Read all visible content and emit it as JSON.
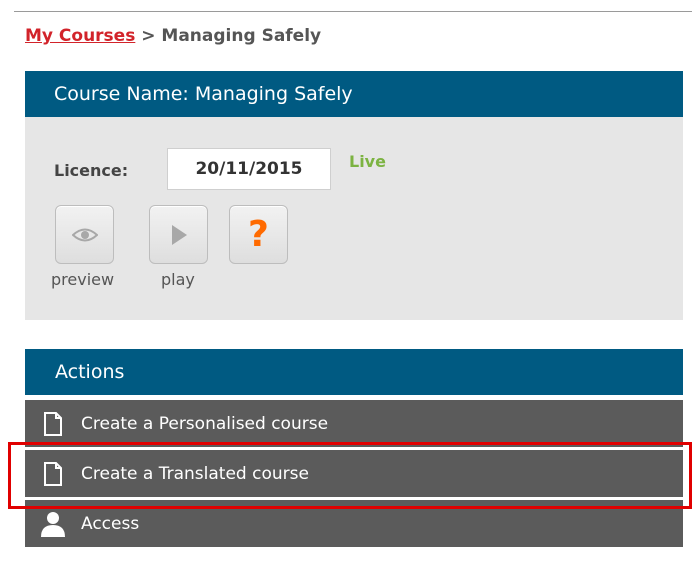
{
  "breadcrumb": {
    "link_label": "My Courses",
    "separator": " > ",
    "current": "Managing Safely"
  },
  "course": {
    "header": "Course Name: Managing Safely",
    "licence_label": "Licence:",
    "licence_value": "20/11/2015",
    "status": "Live",
    "status_color": "#7cb342",
    "buttons": [
      {
        "icon": "eye-icon",
        "label": "preview"
      },
      {
        "icon": "play-icon",
        "label": "play"
      },
      {
        "icon": "help-icon",
        "glyph": "?"
      }
    ]
  },
  "actions": {
    "header": "Actions",
    "items": [
      {
        "icon": "document-icon",
        "label": "Create a Personalised course"
      },
      {
        "icon": "document-icon",
        "label": "Create a Translated course"
      },
      {
        "icon": "user-icon",
        "label": "Access"
      }
    ]
  },
  "colors": {
    "header_bg": "#005a82",
    "panel_bg": "#e6e6e6",
    "action_bg": "#5b5b5b",
    "link": "#d2232a",
    "highlight": "#e00000"
  }
}
